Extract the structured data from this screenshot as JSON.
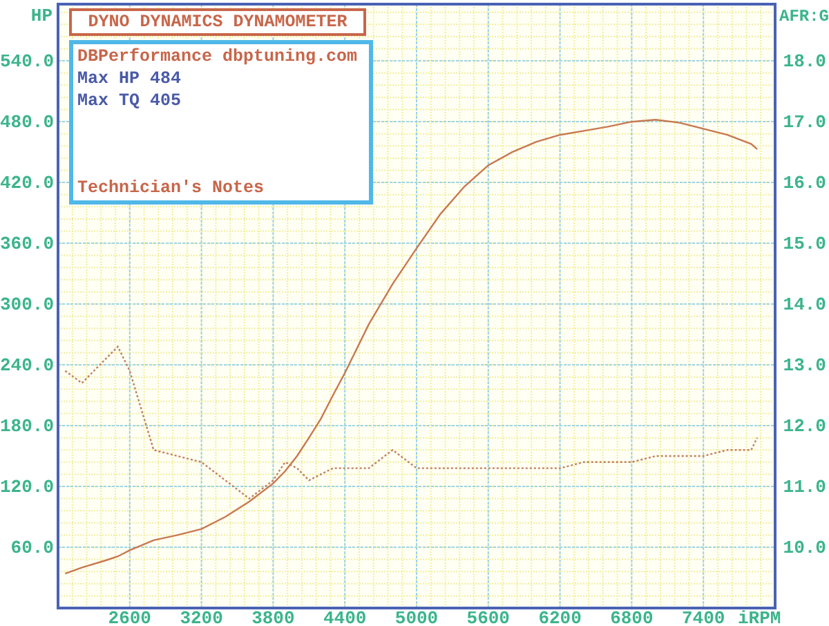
{
  "title_box": {
    "text": "DYNO DYNAMICS DYNAMOMETER"
  },
  "info_box": {
    "lines": [
      {
        "text": "DBPerformance dbptuning.com",
        "kind": "heading"
      },
      {
        "text": "Max HP 484",
        "kind": "value"
      },
      {
        "text": "Max TQ 405",
        "kind": "value"
      }
    ],
    "footer": "Technician's Notes"
  },
  "chart_data": {
    "type": "line",
    "ylabel": "HP",
    "y2label": "AFR:G",
    "xlabel": "iRPM",
    "xlim": [
      2000,
      8000
    ],
    "ylim": [
      0,
      596
    ],
    "y2lim": [
      9,
      18.93
    ],
    "grid": true,
    "xticks": [
      2600,
      3200,
      3800,
      4400,
      5000,
      5600,
      6200,
      6800,
      7400
    ],
    "yticks": [
      {
        "value": 540,
        "label": "540.0"
      },
      {
        "value": 480,
        "label": "480.0"
      },
      {
        "value": 420,
        "label": "420.0"
      },
      {
        "value": 360,
        "label": "360.0"
      },
      {
        "value": 300,
        "label": "300.0"
      },
      {
        "value": 240,
        "label": "240.0"
      },
      {
        "value": 180,
        "label": "180.0"
      },
      {
        "value": 120,
        "label": "120.0"
      },
      {
        "value": 60,
        "label": "60.0"
      }
    ],
    "y2ticks": [
      {
        "value": 18,
        "label": "18.0"
      },
      {
        "value": 17,
        "label": "17.0"
      },
      {
        "value": 16,
        "label": "16.0"
      },
      {
        "value": 15,
        "label": "15.0"
      },
      {
        "value": 14,
        "label": "14.0"
      },
      {
        "value": 13,
        "label": "13.0"
      },
      {
        "value": 12,
        "label": "12.0"
      },
      {
        "value": 11,
        "label": "11.0"
      },
      {
        "value": 10,
        "label": "10.0"
      }
    ],
    "x": [
      2060,
      2200,
      2400,
      2500,
      2600,
      2800,
      3000,
      3200,
      3400,
      3600,
      3800,
      3900,
      4000,
      4100,
      4200,
      4300,
      4400,
      4600,
      4800,
      5000,
      5200,
      5400,
      5600,
      5800,
      6000,
      6200,
      6400,
      6600,
      6800,
      7000,
      7200,
      7400,
      7600,
      7800,
      7850
    ],
    "series": [
      {
        "color": "#c87850",
        "line_style": "solid",
        "values": [
          34,
          40,
          47,
          51,
          57,
          67,
          72,
          78,
          90,
          105,
          123,
          135,
          150,
          168,
          187,
          210,
          232,
          280,
          320,
          355,
          389,
          416,
          437,
          450,
          460,
          467,
          471,
          475,
          480,
          482,
          479,
          473,
          467,
          458,
          453
        ]
      },
      {
        "color": "#c08060",
        "axis": "y2",
        "line_style": "dotted",
        "values": [
          12.9,
          12.7,
          13.1,
          13.3,
          12.9,
          11.6,
          11.5,
          11.4,
          11.1,
          10.8,
          11.1,
          11.4,
          11.3,
          11.1,
          11.2,
          11.3,
          11.3,
          11.3,
          11.6,
          11.3,
          11.3,
          11.3,
          11.3,
          11.3,
          11.3,
          11.3,
          11.4,
          11.4,
          11.4,
          11.5,
          11.5,
          11.5,
          11.6,
          11.6,
          11.8
        ]
      }
    ]
  }
}
